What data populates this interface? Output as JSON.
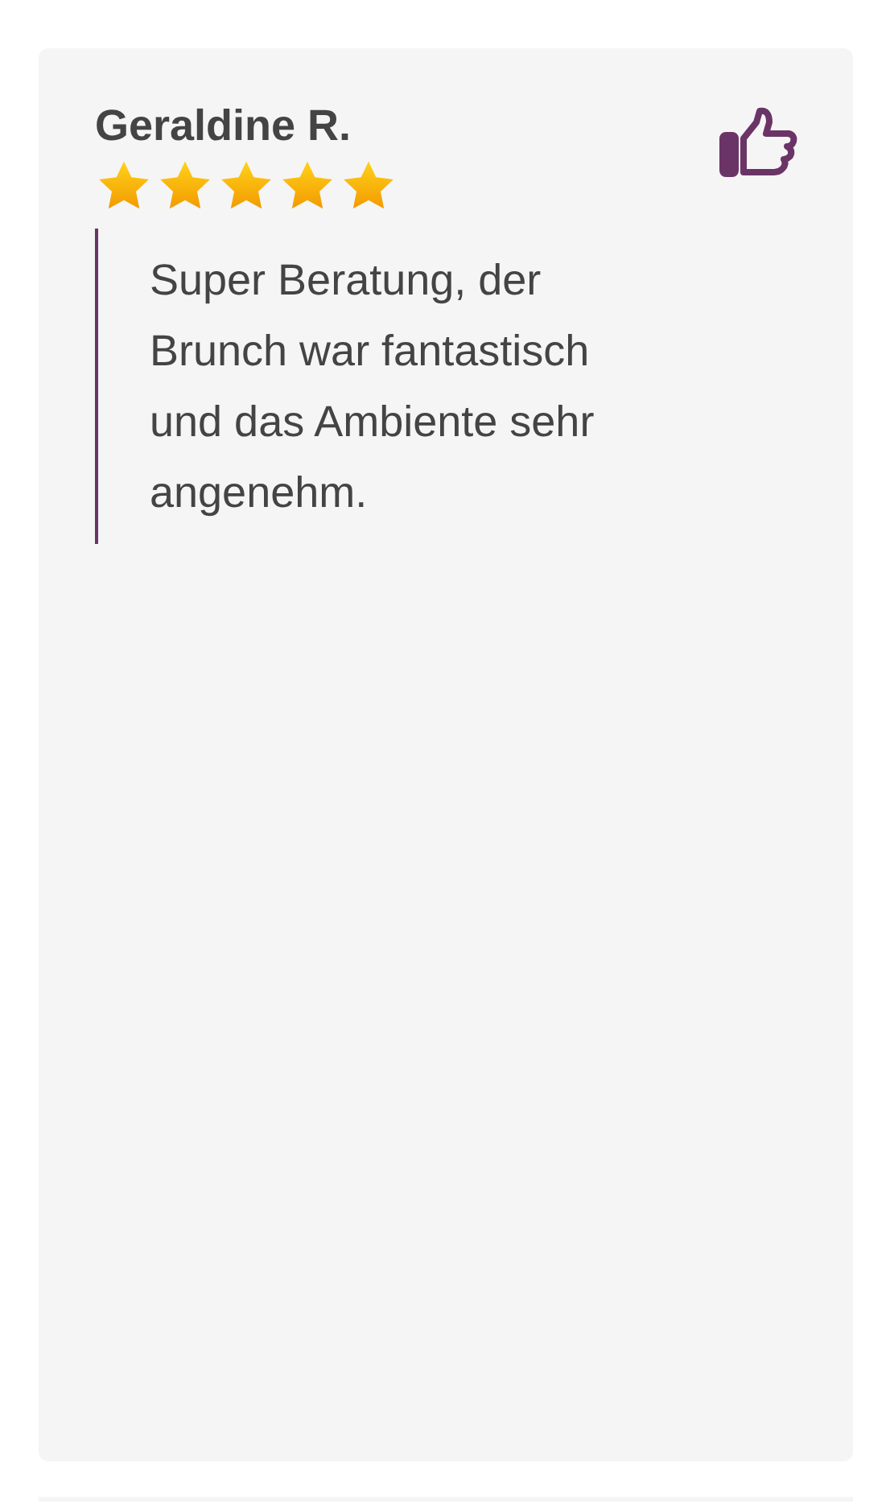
{
  "review": {
    "author": "Geraldine R.",
    "stars": 5,
    "text": "Super Beratung, der Brunch war fantastisch und das Ambiente sehr angenehm."
  }
}
